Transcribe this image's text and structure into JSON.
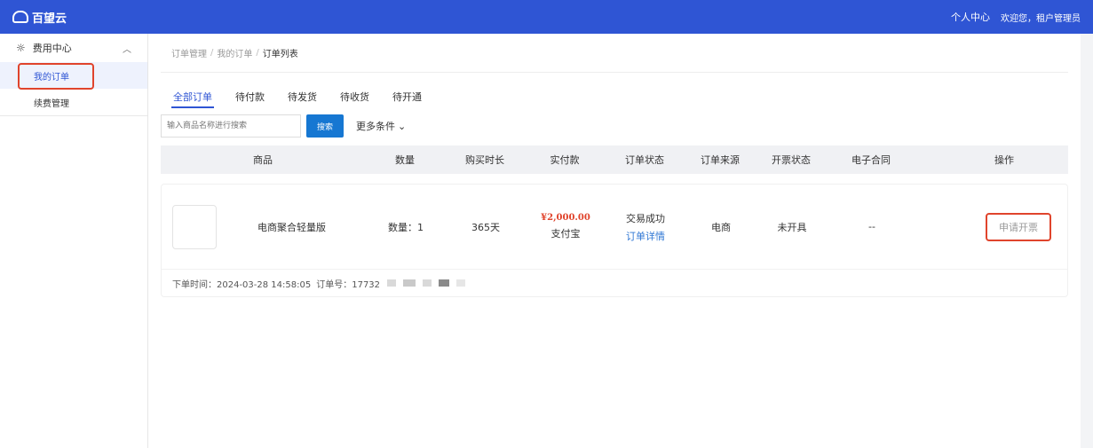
{
  "header": {
    "brand": "百望云",
    "user_center": "个人中心",
    "welcome": "欢迎您，租户管理员",
    "brand_color": "#2f55d4"
  },
  "sidebar": {
    "group_label": "费用中心",
    "group_icon": "lightbulb-icon",
    "items": [
      {
        "label": "我的订单",
        "active": true
      },
      {
        "label": "续费管理",
        "active": false
      }
    ]
  },
  "breadcrumb": {
    "items": [
      "订单管理",
      "我的订单"
    ],
    "current": "订单列表"
  },
  "tabs": [
    {
      "label": "全部订单",
      "active": true
    },
    {
      "label": "待付款",
      "active": false
    },
    {
      "label": "待发货",
      "active": false
    },
    {
      "label": "待收货",
      "active": false
    },
    {
      "label": "待开通",
      "active": false
    }
  ],
  "search": {
    "placeholder": "输入商品名称进行搜索",
    "button_label": "搜索",
    "more_label": "更多条件"
  },
  "table": {
    "headers": [
      "商品",
      "数量",
      "购买时长",
      "实付款",
      "订单状态",
      "订单来源",
      "开票状态",
      "电子合同",
      "操作"
    ]
  },
  "order": {
    "product_name": "电商聚合轻量版",
    "quantity": "数量：1",
    "duration": "365天",
    "price": "¥2,000.00",
    "payment_method": "支付宝",
    "status": "交易成功",
    "detail_link": "订单详情",
    "source": "电商",
    "invoice_status": "未开具",
    "contract": "--",
    "action_label": "申请开票",
    "order_time": "下单时间：2024-03-28 14:58:05",
    "order_no": "订单号：17732"
  },
  "colors": {
    "accent": "#2f55d4",
    "price": "#e0442c",
    "highlight_box": "#e0442c",
    "search_button": "#1677d2"
  }
}
